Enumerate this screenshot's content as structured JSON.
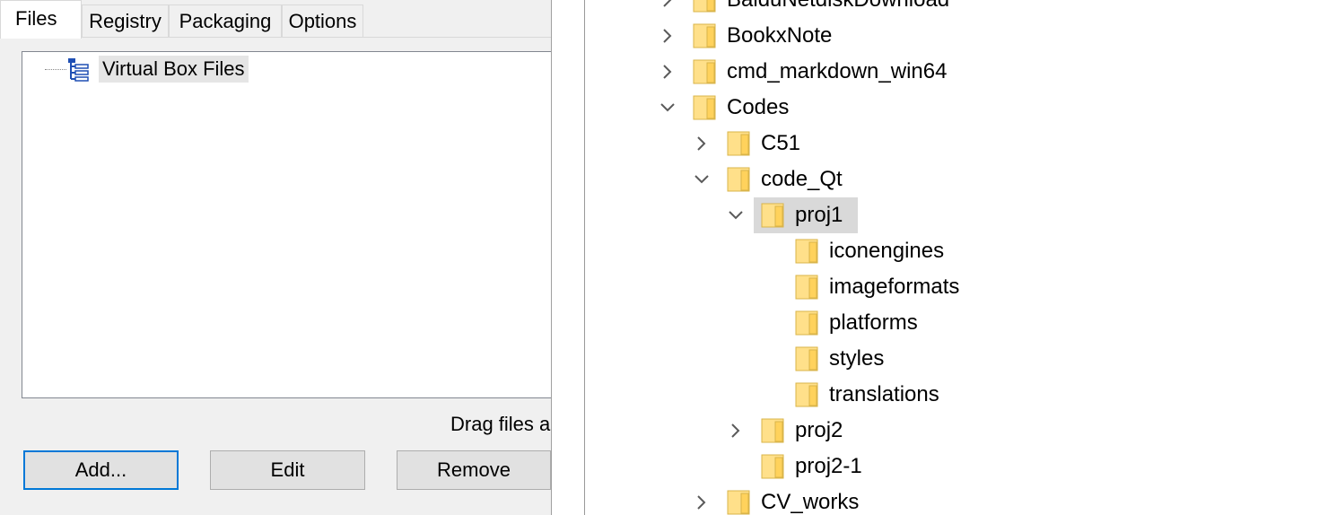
{
  "dialog": {
    "tabs": [
      "Files",
      "Registry",
      "Packaging",
      "Options"
    ],
    "tree_root_label": "Virtual Box Files",
    "drag_hint": "Drag files ar",
    "buttons": {
      "add": "Add...",
      "edit": "Edit",
      "remove": "Remove"
    }
  },
  "explorer": {
    "items": [
      {
        "label": "BaiduNetdiskDownload",
        "expander": "collapsed",
        "level": 0
      },
      {
        "label": "BookxNote",
        "expander": "collapsed",
        "level": 0
      },
      {
        "label": "cmd_markdown_win64",
        "expander": "collapsed",
        "level": 0
      },
      {
        "label": "Codes",
        "expander": "expanded",
        "level": 0
      },
      {
        "label": "C51",
        "expander": "collapsed",
        "level": 1
      },
      {
        "label": "code_Qt",
        "expander": "expanded",
        "level": 1
      },
      {
        "label": "proj1",
        "expander": "expanded",
        "level": 2,
        "selected": true
      },
      {
        "label": "iconengines",
        "expander": "none",
        "level": 3
      },
      {
        "label": "imageformats",
        "expander": "none",
        "level": 3
      },
      {
        "label": "platforms",
        "expander": "none",
        "level": 3
      },
      {
        "label": "styles",
        "expander": "none",
        "level": 3
      },
      {
        "label": "translations",
        "expander": "none",
        "level": 3
      },
      {
        "label": "proj2",
        "expander": "collapsed",
        "level": 2
      },
      {
        "label": "proj2-1",
        "expander": "none",
        "level": 2
      },
      {
        "label": "CV_works",
        "expander": "collapsed",
        "level": 1
      }
    ]
  },
  "colors": {
    "folder_fill": "#ffe08a",
    "folder_edge": "#d9b44a",
    "focus_border": "#0078d7",
    "selection": "#d9d9d9"
  }
}
